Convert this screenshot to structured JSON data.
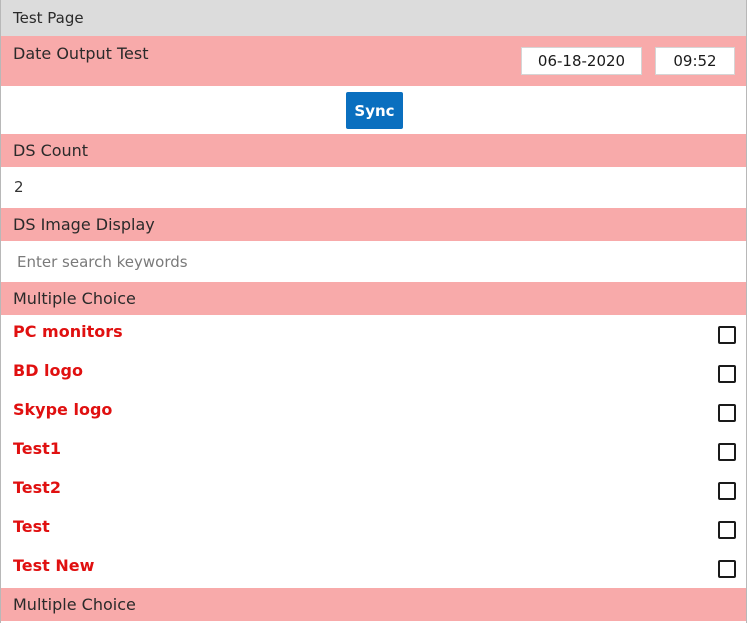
{
  "page": {
    "title": "Test Page"
  },
  "date_output": {
    "label": "Date Output Test",
    "date": "06-18-2020",
    "time": "09:52"
  },
  "sync": {
    "label": "Sync"
  },
  "ds_count": {
    "header": "DS Count",
    "value": "2"
  },
  "ds_image": {
    "header": "DS Image Display",
    "search_placeholder": "Enter search keywords"
  },
  "multiple_choice": {
    "header": "Multiple Choice",
    "items": [
      {
        "label": "PC monitors",
        "checked": false
      },
      {
        "label": "BD logo",
        "checked": false
      },
      {
        "label": "Skype logo",
        "checked": false
      },
      {
        "label": "Test1",
        "checked": false
      },
      {
        "label": "Test2",
        "checked": false
      },
      {
        "label": "Test",
        "checked": false
      },
      {
        "label": "Test New",
        "checked": false
      }
    ]
  },
  "multiple_choice_2": {
    "header": "Multiple Choice"
  },
  "colors": {
    "header_bg": "#f8aaaa",
    "title_bg": "#dcdcdc",
    "accent_button": "#0a6fbf",
    "choice_text": "#e01010"
  }
}
